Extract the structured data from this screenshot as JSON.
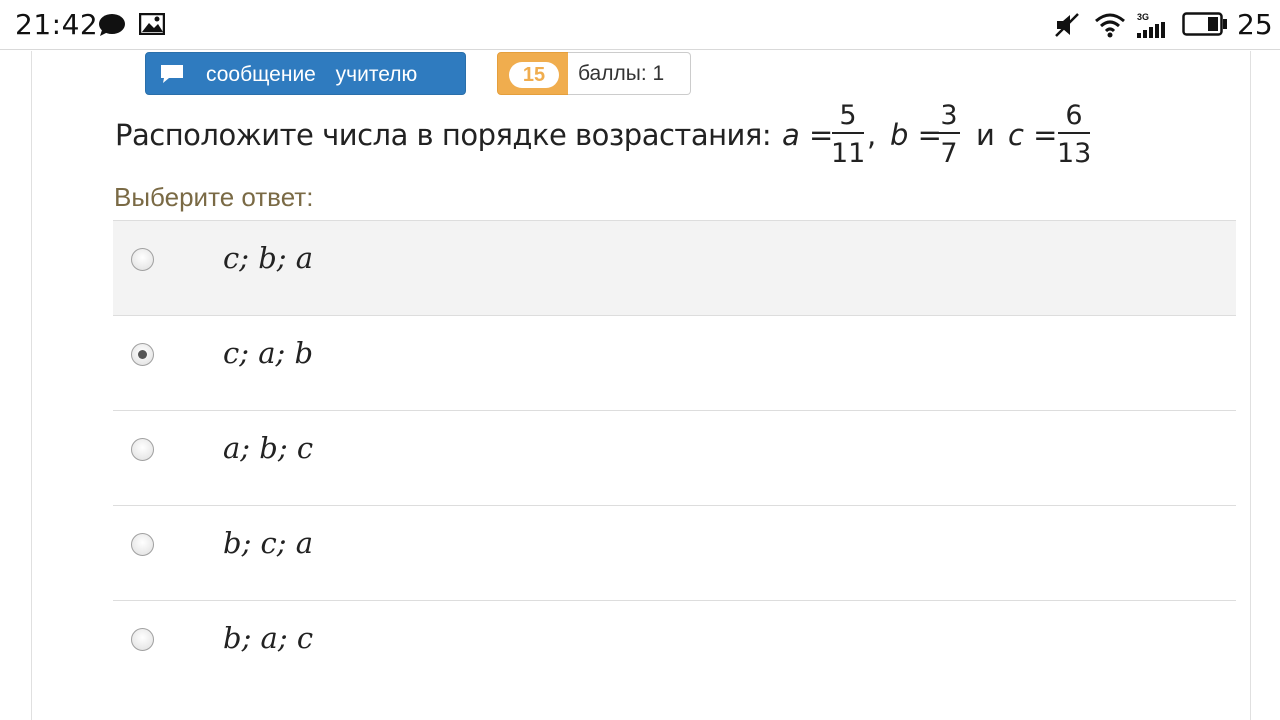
{
  "status_bar": {
    "time": "21:42",
    "network": "3G",
    "battery": "25",
    "icons": [
      "chat-bubble-icon",
      "image-icon",
      "mute-icon",
      "wifi-icon",
      "signal-icon",
      "battery-icon"
    ]
  },
  "toolbar": {
    "message_button_label": "сообщение учителю",
    "message_icon": "chat-bubble-icon",
    "score_badge": "15",
    "score_text": "баллы: 1"
  },
  "question": {
    "text": "Расположите числа в порядке возрастания:",
    "a_var": "a",
    "a_num": "5",
    "a_den": "11",
    "b_var": "b",
    "b_num": "3",
    "b_den": "7",
    "conj": "и",
    "c_var": "c",
    "c_num": "6",
    "c_den": "13"
  },
  "answer_prompt": "Выберите ответ:",
  "options": [
    {
      "label": "c; b; a",
      "selected": false
    },
    {
      "label": "c; a; b",
      "selected": true
    },
    {
      "label": "a; b; c",
      "selected": false
    },
    {
      "label": "b; c; a",
      "selected": false
    },
    {
      "label": "b; a; c",
      "selected": false
    }
  ],
  "colors": {
    "primary_button": "#2f7bbf",
    "badge": "#f0ad4e",
    "answer_prompt": "#7a6a45",
    "highlight_row": "#f3f3f3"
  }
}
